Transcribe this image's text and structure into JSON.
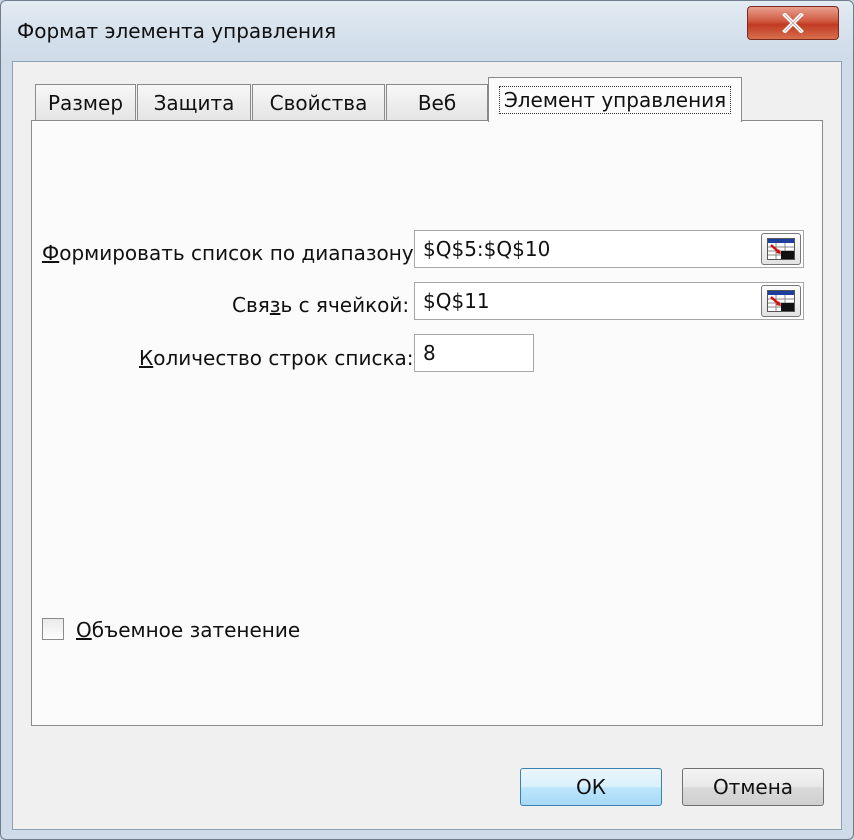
{
  "window": {
    "title": "Формат элемента управления"
  },
  "tabs": [
    {
      "label": "Размер",
      "active": false
    },
    {
      "label": "Защита",
      "active": false
    },
    {
      "label": "Свойства",
      "active": false
    },
    {
      "label": "Веб",
      "active": false
    },
    {
      "label": "Элемент управления",
      "active": true
    }
  ],
  "fields": {
    "input_range": {
      "label": "Формировать список по диапазону:",
      "accel": "Ф",
      "value": "$Q$5:$Q$10"
    },
    "cell_link": {
      "label_pre": "Свя",
      "accel": "з",
      "label_post": "ь с ячейкой:",
      "value": "$Q$11"
    },
    "dropdown_lines": {
      "accel": "К",
      "label_post": "оличество строк списка:",
      "value": "8"
    }
  },
  "shading": {
    "accel": "О",
    "label_post": "бъемное затенение",
    "checked": false
  },
  "buttons": {
    "ok": "ОК",
    "cancel": "Отмена"
  },
  "colors": {
    "titlebar": "#d3dfeb",
    "close_button": "#c13a22",
    "default_button": "#bee6fd"
  }
}
